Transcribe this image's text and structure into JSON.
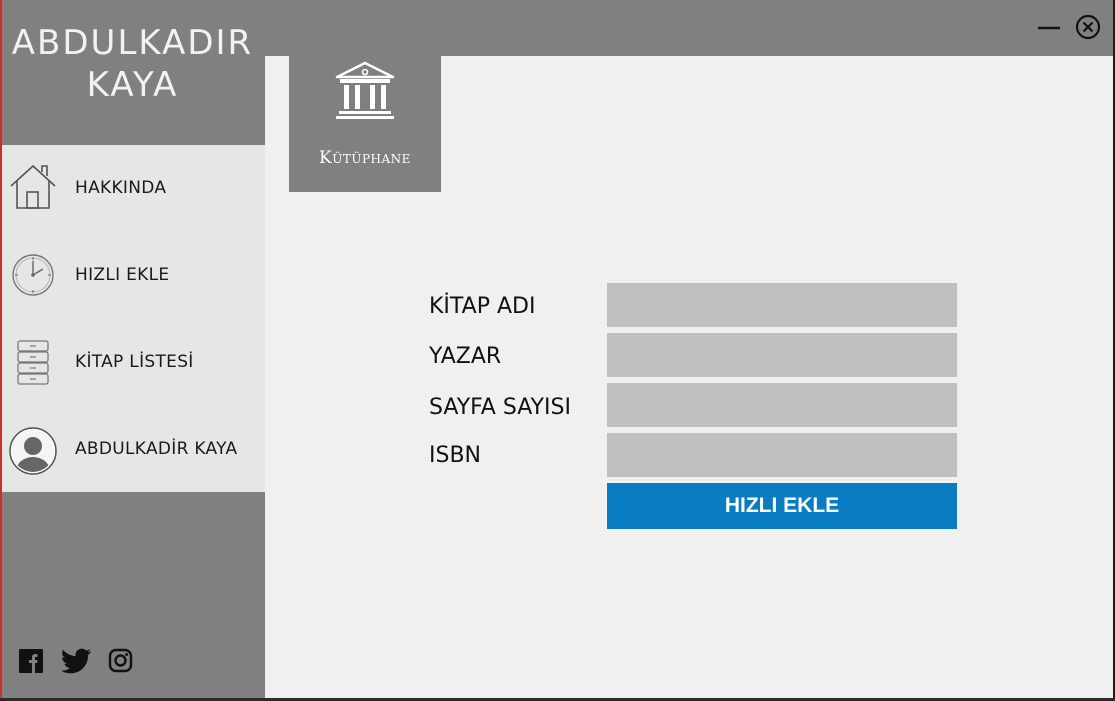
{
  "window": {
    "brand_line1": "ABDULKADIR",
    "brand_line2": "KAYA"
  },
  "menu": {
    "items": [
      {
        "label": "HAKKINDA",
        "icon": "home-icon"
      },
      {
        "label": "HIZLI EKLE",
        "icon": "clock-icon"
      },
      {
        "label": "KİTAP LİSTESİ",
        "icon": "server-list-icon"
      },
      {
        "label": "ABDULKADİR KAYA",
        "icon": "user-avatar-icon"
      }
    ]
  },
  "tile": {
    "label": "Kütüphane",
    "icon": "library-building-icon"
  },
  "form": {
    "fields": [
      {
        "label": "KİTAP ADI",
        "value": ""
      },
      {
        "label": "YAZAR",
        "value": ""
      },
      {
        "label": "SAYFA SAYISI",
        "value": ""
      },
      {
        "label": "ISBN",
        "value": ""
      }
    ],
    "submit_label": "HIZLI EKLE"
  },
  "social": [
    "facebook-icon",
    "twitter-icon",
    "instagram-icon"
  ],
  "colors": {
    "sidebar": "#808080",
    "menu_bg": "#e6e6e6",
    "content_bg": "#f0f0f0",
    "field_bg": "#c0c0c0",
    "accent": "#0a7cc2"
  }
}
